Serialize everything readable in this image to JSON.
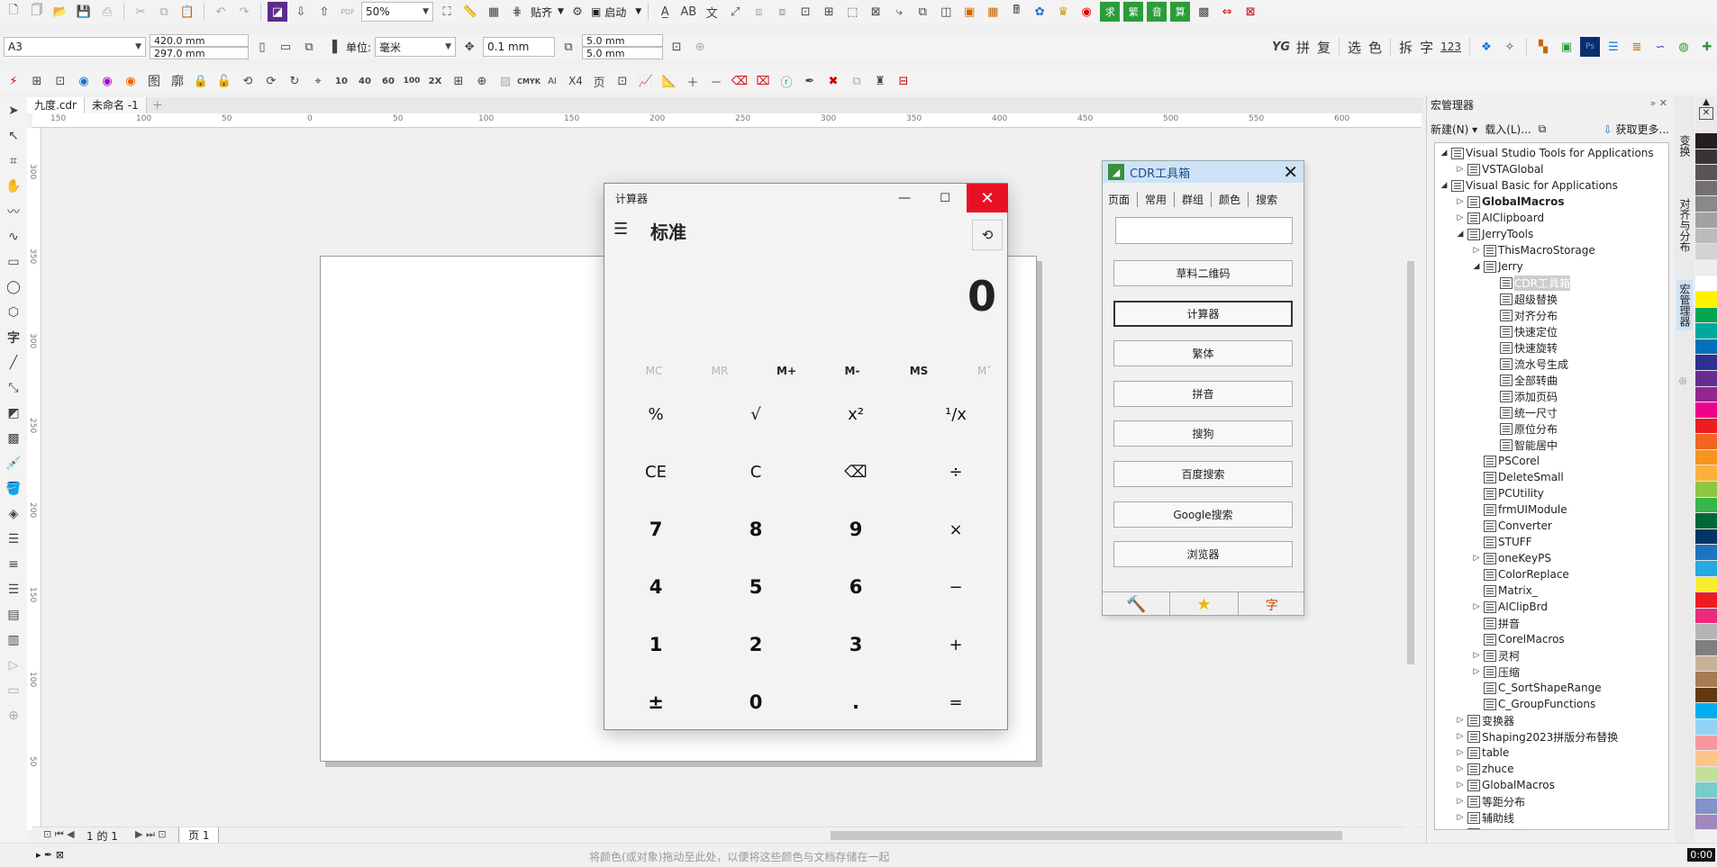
{
  "doc_tabs": [
    "九度.cdr",
    "未命名 -1"
  ],
  "toolbar1": {
    "zoom": "50%",
    "snap": "贴齐",
    "launch": "启动"
  },
  "toolbar2": {
    "page_size": "A3",
    "width": "420.0 mm",
    "height": "297.0 mm",
    "unit_label": "单位:",
    "unit": "毫米",
    "nudge": "0.1 mm",
    "dup_x": "5.0 mm",
    "dup_y": "5.0 mm",
    "text_buttons": [
      "拼",
      "复",
      "选",
      "色",
      "拆",
      "字",
      "123"
    ]
  },
  "toolbar3": {
    "labels": [
      "图",
      "廓",
      "10",
      "40",
      "60",
      "100",
      "2X",
      "CMYK",
      "X4",
      "页"
    ]
  },
  "ruler": {
    "top_ticks": [
      "150",
      "100",
      "50",
      "0",
      "50",
      "100",
      "150",
      "200",
      "250",
      "300",
      "350",
      "400",
      "450",
      "500",
      "550",
      "600"
    ],
    "left_ticks": [
      "300",
      "350",
      "300",
      "250",
      "200",
      "150",
      "100",
      "50",
      "0"
    ]
  },
  "calculator": {
    "title": "计算器",
    "mode": "标准",
    "display": "0",
    "memory": [
      "MC",
      "MR",
      "M+",
      "M-",
      "MS",
      "M˅"
    ],
    "keys": [
      [
        "%",
        "√",
        "x²",
        "¹/x"
      ],
      [
        "CE",
        "C",
        "⌫",
        "÷"
      ],
      [
        "7",
        "8",
        "9",
        "×"
      ],
      [
        "4",
        "5",
        "6",
        "−"
      ],
      [
        "1",
        "2",
        "3",
        "+"
      ],
      [
        "±",
        "0",
        ".",
        "="
      ]
    ]
  },
  "cdr_tool": {
    "title": "CDR工具箱",
    "tabs": [
      "页面",
      "常用",
      "群组",
      "颜色",
      "搜索"
    ],
    "buttons": [
      "草料二维码",
      "计算器",
      "繁体",
      "拼音",
      "搜狗",
      "百度搜索",
      "Google搜索",
      "浏览器"
    ]
  },
  "macro_manager": {
    "title": "宏管理器",
    "new_btn": "新建(N)",
    "load_btn": "载入(L)...",
    "more_btn": "获取更多...",
    "tree": [
      {
        "t": "Visual Studio Tools for Applications",
        "lvl": 0,
        "ex": "◢"
      },
      {
        "t": "VSTAGlobal",
        "lvl": 1,
        "ex": "▷"
      },
      {
        "t": "Visual Basic for Applications",
        "lvl": 0,
        "ex": "◢"
      },
      {
        "t": "GlobalMacros",
        "lvl": 1,
        "ex": "▷",
        "b": true
      },
      {
        "t": "AIClipboard",
        "lvl": 1,
        "ex": "▷"
      },
      {
        "t": "JerryTools",
        "lvl": 1,
        "ex": "◢"
      },
      {
        "t": "ThisMacroStorage",
        "lvl": 2,
        "ex": "▷"
      },
      {
        "t": "Jerry",
        "lvl": 2,
        "ex": "◢"
      },
      {
        "t": "CDR工具箱",
        "lvl": 3,
        "ex": "",
        "sel": true
      },
      {
        "t": "超级替换",
        "lvl": 3,
        "ex": ""
      },
      {
        "t": "对齐分布",
        "lvl": 3,
        "ex": ""
      },
      {
        "t": "快速定位",
        "lvl": 3,
        "ex": ""
      },
      {
        "t": "快速旋转",
        "lvl": 3,
        "ex": ""
      },
      {
        "t": "流水号生成",
        "lvl": 3,
        "ex": ""
      },
      {
        "t": "全部转曲",
        "lvl": 3,
        "ex": ""
      },
      {
        "t": "添加页码",
        "lvl": 3,
        "ex": ""
      },
      {
        "t": "统一尺寸",
        "lvl": 3,
        "ex": ""
      },
      {
        "t": "原位分布",
        "lvl": 3,
        "ex": ""
      },
      {
        "t": "智能居中",
        "lvl": 3,
        "ex": ""
      },
      {
        "t": "PSCorel",
        "lvl": 2,
        "ex": ""
      },
      {
        "t": "DeleteSmall",
        "lvl": 2,
        "ex": ""
      },
      {
        "t": "PCUtility",
        "lvl": 2,
        "ex": ""
      },
      {
        "t": "frmUIModule",
        "lvl": 2,
        "ex": ""
      },
      {
        "t": "Converter",
        "lvl": 2,
        "ex": ""
      },
      {
        "t": "STUFF",
        "lvl": 2,
        "ex": ""
      },
      {
        "t": "oneKeyPS",
        "lvl": 2,
        "ex": "▷"
      },
      {
        "t": "ColorReplace",
        "lvl": 2,
        "ex": ""
      },
      {
        "t": "Matrix_",
        "lvl": 2,
        "ex": ""
      },
      {
        "t": "AIClipBrd",
        "lvl": 2,
        "ex": "▷"
      },
      {
        "t": "拼音",
        "lvl": 2,
        "ex": ""
      },
      {
        "t": "CorelMacros",
        "lvl": 2,
        "ex": ""
      },
      {
        "t": "灵柯",
        "lvl": 2,
        "ex": "▷"
      },
      {
        "t": "压缩",
        "lvl": 2,
        "ex": "▷"
      },
      {
        "t": "C_SortShapeRange",
        "lvl": 2,
        "ex": ""
      },
      {
        "t": "C_GroupFunctions",
        "lvl": 2,
        "ex": ""
      },
      {
        "t": "变换器",
        "lvl": 1,
        "ex": "▷"
      },
      {
        "t": "Shaping2023拼版分布替换",
        "lvl": 1,
        "ex": "▷"
      },
      {
        "t": "table",
        "lvl": 1,
        "ex": "▷"
      },
      {
        "t": "zhuce",
        "lvl": 1,
        "ex": "▷"
      },
      {
        "t": "GlobalMacros",
        "lvl": 1,
        "ex": "▷"
      },
      {
        "t": "等距分布",
        "lvl": 1,
        "ex": "▷"
      },
      {
        "t": "辅助线",
        "lvl": 1,
        "ex": "▷"
      },
      {
        "t": "cpg_选择规图",
        "lvl": 1,
        "ex": "▷"
      }
    ]
  },
  "dock_tabs": [
    "变换",
    "对齐与分布",
    "宏管理器"
  ],
  "page_nav": {
    "page_info": "1 的 1",
    "page_tab": "页 1"
  },
  "status": {
    "hint": "将颜色(或对象)拖动至此处，以便将这些颜色与文档存储在一起",
    "time": "0:00"
  },
  "palette": [
    "#231f20",
    "#3a3334",
    "#5a5455",
    "#727071",
    "#8a8889",
    "#a3a1a2",
    "#bcbaba",
    "#d4d2d2",
    "#eeeeee",
    "#ffffff",
    "#fff200",
    "#00a651",
    "#00a99d",
    "#0072bc",
    "#2e3192",
    "#662d91",
    "#92278f",
    "#ec008c",
    "#ed1c24",
    "#f26522",
    "#f7941d",
    "#fbb040",
    "#8dc63f",
    "#39b54a",
    "#006837",
    "#003663",
    "#1c75bc",
    "#27aae1",
    "#f9ed32",
    "#ed1c24",
    "#ee2a7b",
    "#b5b5b5",
    "#7f7f7f",
    "#c7b299",
    "#a67c52",
    "#603913",
    "#00aeef",
    "#92d3f5",
    "#f5989d",
    "#fdc689",
    "#c4df9b",
    "#7accc8",
    "#8393ca",
    "#a187be"
  ]
}
